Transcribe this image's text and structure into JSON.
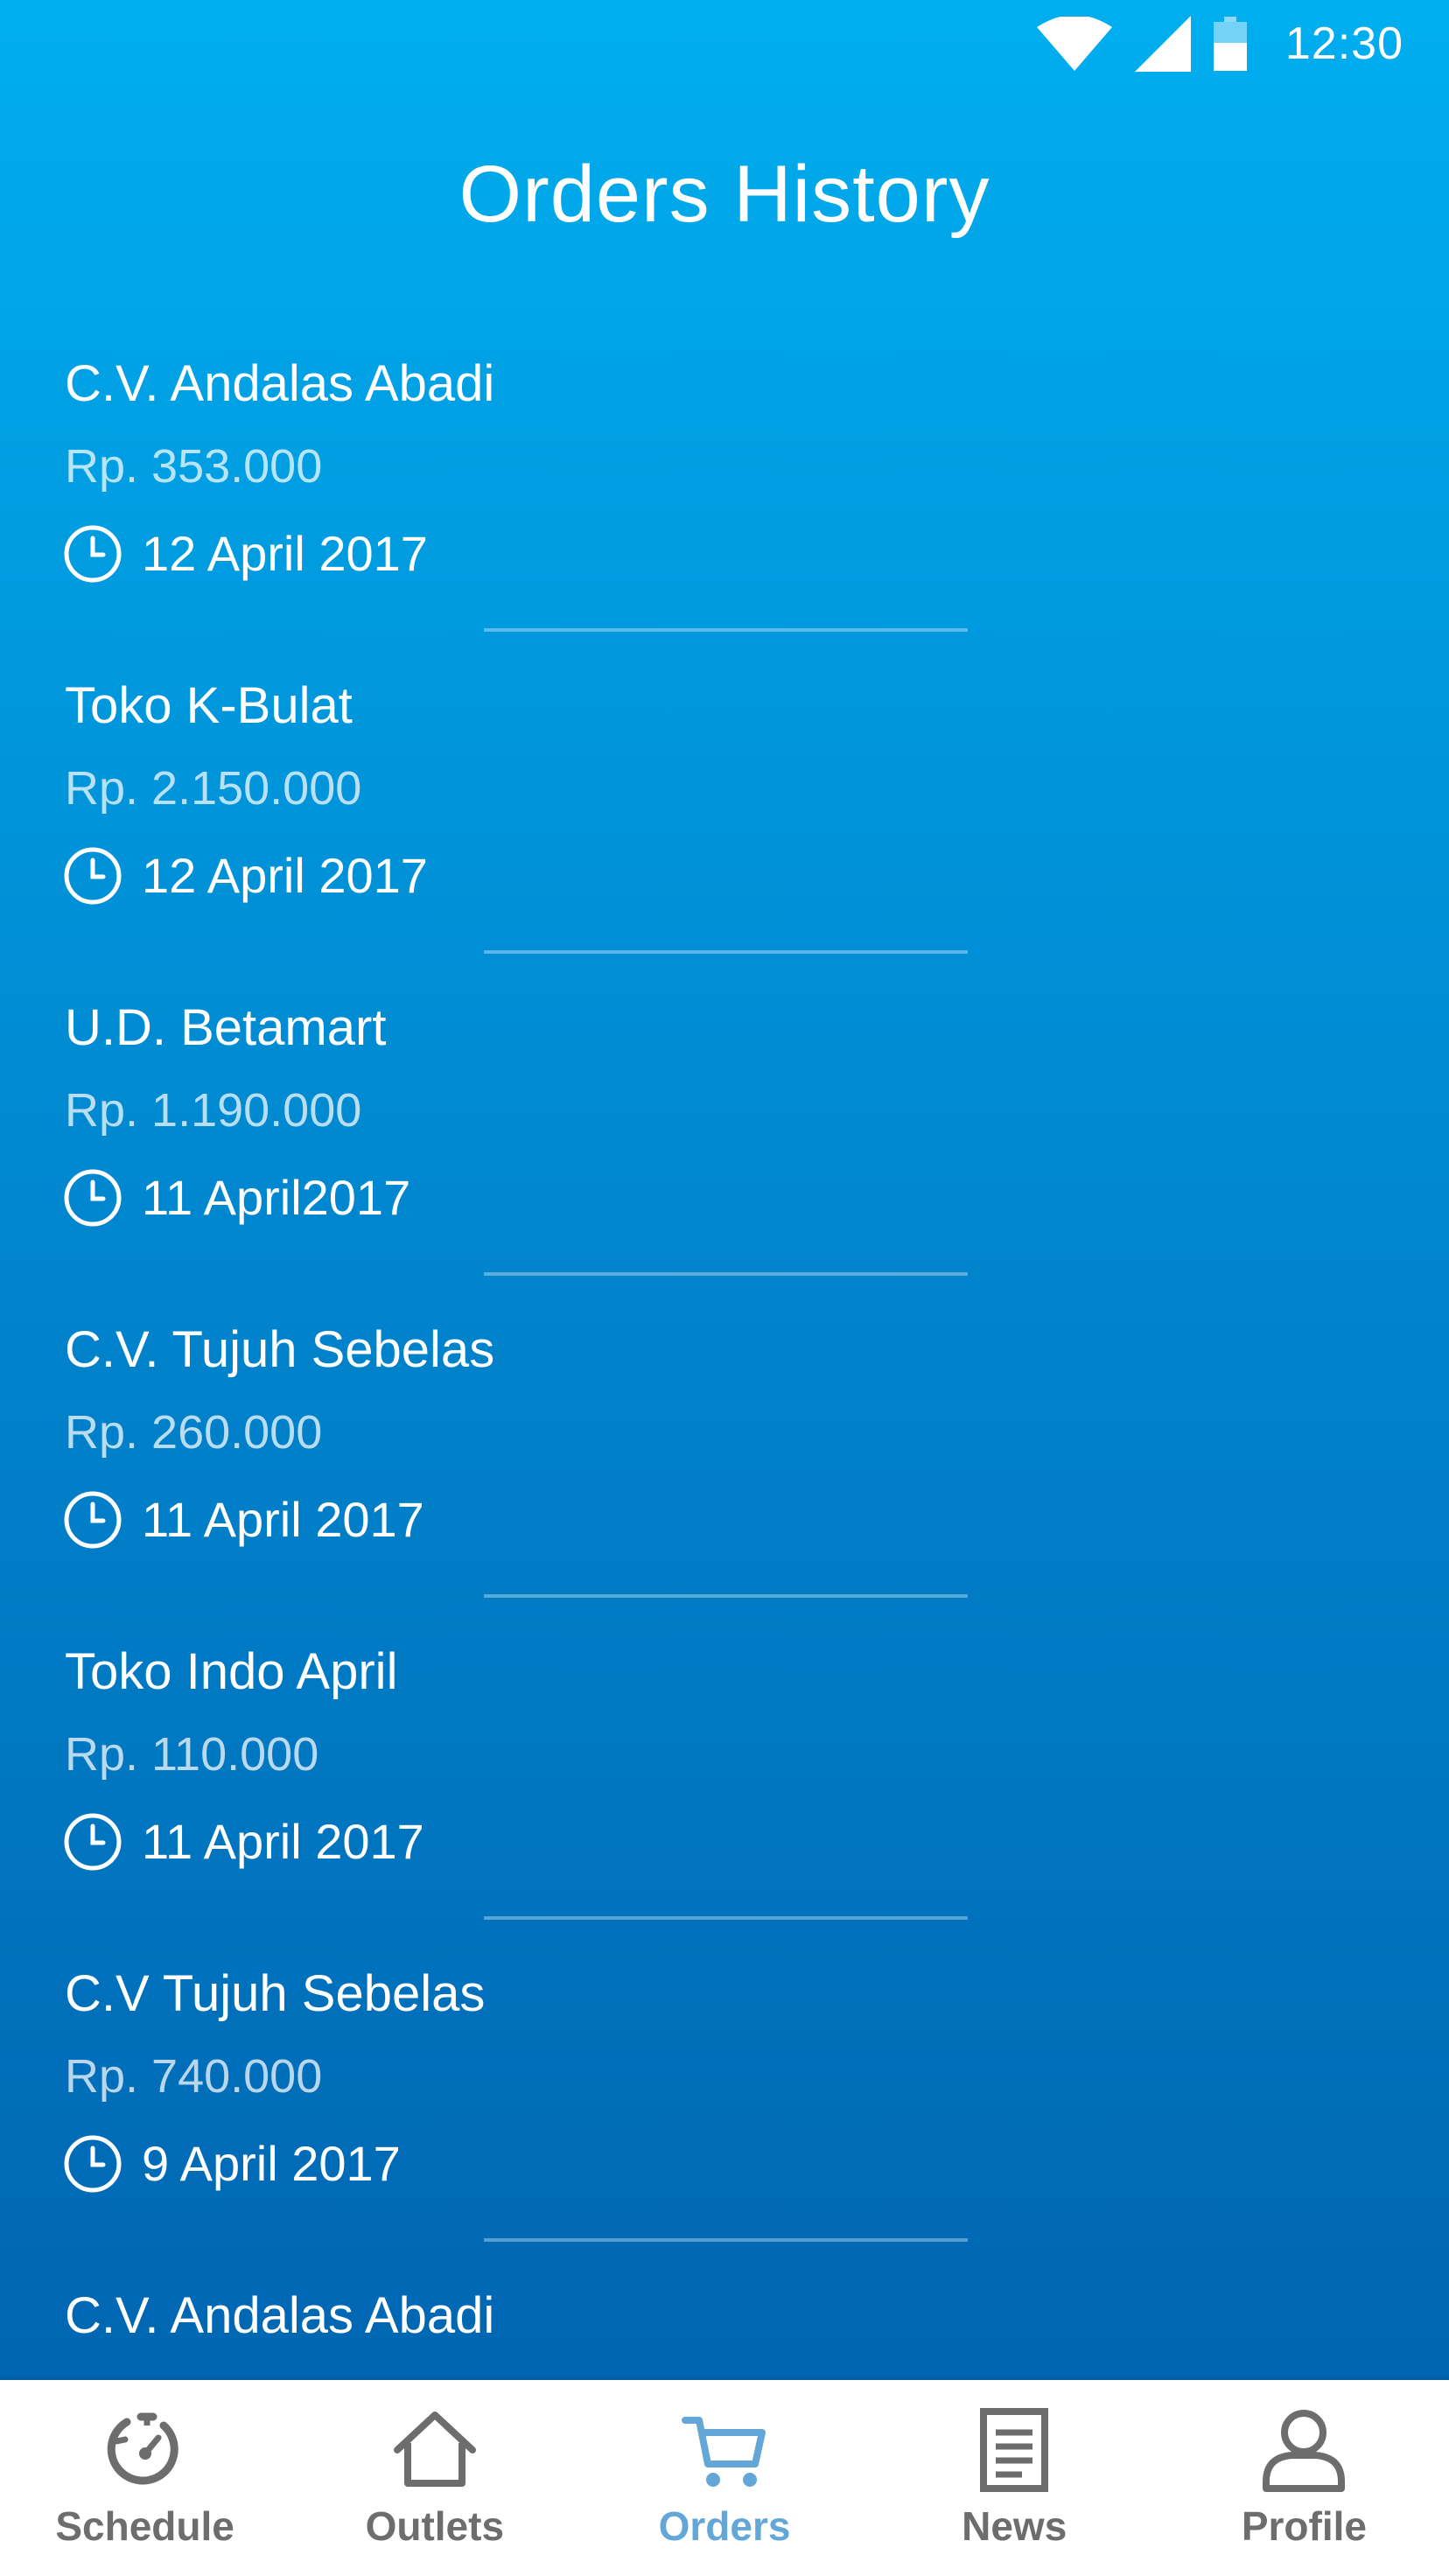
{
  "status_bar": {
    "time": "12:30",
    "icons": [
      "wifi-icon",
      "signal-icon",
      "battery-icon"
    ]
  },
  "header": {
    "title": "Orders History"
  },
  "orders": [
    {
      "name": "C.V. Andalas Abadi",
      "amount": "Rp. 353.000",
      "date": "12 April 2017"
    },
    {
      "name": "Toko K-Bulat",
      "amount": "Rp. 2.150.000",
      "date": "12 April 2017"
    },
    {
      "name": "U.D. Betamart",
      "amount": "Rp. 1.190.000",
      "date": "11 April2017"
    },
    {
      "name": "C.V. Tujuh Sebelas",
      "amount": "Rp. 260.000",
      "date": "11 April 2017"
    },
    {
      "name": "Toko Indo April",
      "amount": "Rp. 110.000",
      "date": "11 April 2017"
    },
    {
      "name": "C.V Tujuh Sebelas",
      "amount": "Rp. 740.000",
      "date": "9 April 2017"
    },
    {
      "name": "C.V. Andalas Abadi",
      "amount": "",
      "date": ""
    }
  ],
  "bottom_nav": {
    "active": "orders",
    "items": [
      {
        "id": "schedule",
        "label": "Schedule",
        "icon": "stopwatch-icon"
      },
      {
        "id": "outlets",
        "label": "Outlets",
        "icon": "home-icon"
      },
      {
        "id": "orders",
        "label": "Orders",
        "icon": "cart-icon"
      },
      {
        "id": "news",
        "label": "News",
        "icon": "document-icon"
      },
      {
        "id": "profile",
        "label": "Profile",
        "icon": "user-icon"
      }
    ]
  },
  "colors": {
    "gradient_top": "#00aeef",
    "gradient_bottom": "#0060ad",
    "nav_active": "#63a6d8",
    "nav_inactive": "#6d6d6d"
  }
}
